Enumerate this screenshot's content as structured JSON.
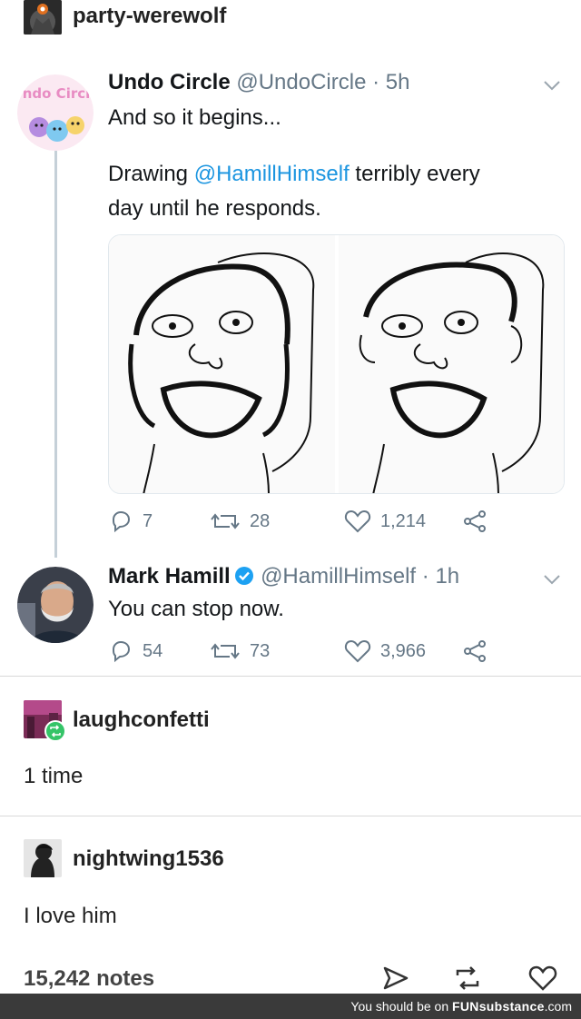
{
  "post": {
    "blog_name": "party-werewolf"
  },
  "tweets": [
    {
      "display_name": "Undo Circle",
      "handle": "@UndoCircle",
      "separator": " · ",
      "time": "5h",
      "line1": "And so it begins...",
      "line2_prefix": "Drawing ",
      "mention": "@HamillHimself",
      "line2_suffix": " terribly every",
      "line3": "day until he responds.",
      "avatar_text": "Undo Circle",
      "reply_count": "7",
      "retweet_count": "28",
      "like_count": "1,214"
    },
    {
      "display_name": "Mark Hamill",
      "handle": "@HamillHimself",
      "separator": " · ",
      "time": "1h",
      "text": "You can stop now.",
      "reply_count": "54",
      "retweet_count": "73",
      "like_count": "3,966"
    }
  ],
  "reblogs": [
    {
      "username": "laughconfetti",
      "text": "1 time"
    },
    {
      "username": "nightwing1536",
      "text": "I love him"
    }
  ],
  "notes": {
    "count_label": "15,242 notes"
  },
  "footer": {
    "prefix": "You should be on ",
    "brand_fun": "FUN",
    "brand_rest": "substance",
    "suffix": ".com"
  },
  "colors": {
    "mention": "#1b95e0",
    "verified": "#1da1f2",
    "twitter_grey": "#657786",
    "thread_line": "#c5d0d8",
    "footer_bg": "#3a3a3a"
  },
  "icons": [
    "reply-icon",
    "retweet-icon",
    "like-icon",
    "share-icon",
    "chevron-down-icon",
    "verified-badge-icon",
    "reblog-badge-icon",
    "send-icon",
    "reblog-icon",
    "heart-icon"
  ]
}
